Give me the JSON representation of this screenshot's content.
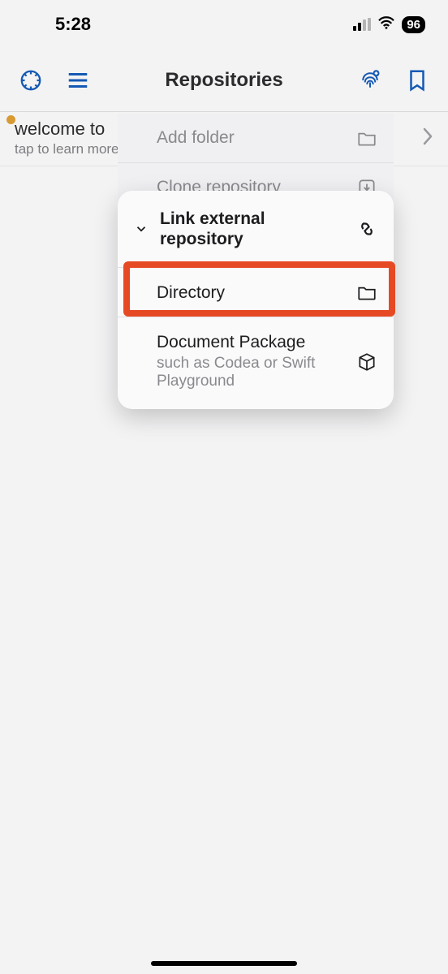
{
  "status": {
    "time": "5:28",
    "battery": "96"
  },
  "nav": {
    "title": "Repositories"
  },
  "welcome": {
    "title": "welcome to",
    "sub": "tap to learn more"
  },
  "popoverFaded": {
    "addFolder": "Add folder",
    "cloneRepo": "Clone repository"
  },
  "popover": {
    "linkExternal": "Link external repository",
    "directory": "Directory",
    "docPackage": {
      "title": "Document Package",
      "sub": "such as Codea or Swift Playground"
    }
  }
}
